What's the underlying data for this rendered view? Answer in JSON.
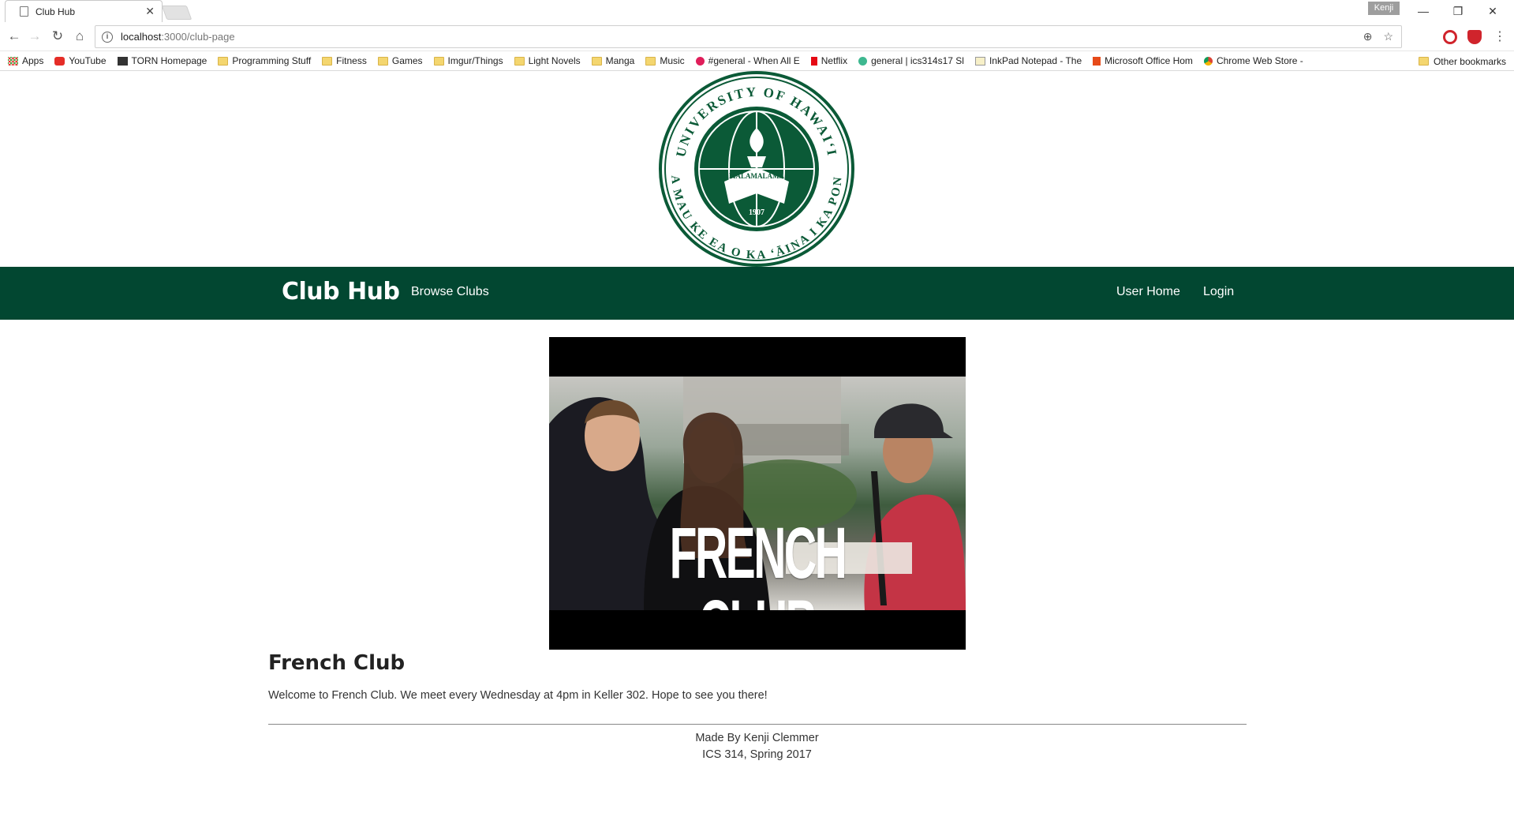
{
  "browser": {
    "tab_title": "Club Hub",
    "profile_name": "Kenji",
    "url_host": "localhost",
    "url_path": ":3000/club-page",
    "bookmarks": [
      {
        "label": "Apps",
        "icon": "apps-grid-icon"
      },
      {
        "label": "YouTube",
        "icon": "youtube-icon"
      },
      {
        "label": "TORN Homepage",
        "icon": "torn-icon"
      },
      {
        "label": "Programming Stuff",
        "icon": "folder-icon"
      },
      {
        "label": "Fitness",
        "icon": "folder-icon"
      },
      {
        "label": "Games",
        "icon": "folder-icon"
      },
      {
        "label": "Imgur/Things",
        "icon": "folder-icon"
      },
      {
        "label": "Light Novels",
        "icon": "folder-icon"
      },
      {
        "label": "Manga",
        "icon": "folder-icon"
      },
      {
        "label": "Music",
        "icon": "folder-icon"
      },
      {
        "label": "#general - When All E",
        "icon": "slack-icon"
      },
      {
        "label": "Netflix",
        "icon": "netflix-icon"
      },
      {
        "label": "general | ics314s17 Sl",
        "icon": "slack-icon"
      },
      {
        "label": "InkPad Notepad - The",
        "icon": "notepad-icon"
      },
      {
        "label": "Microsoft Office Hom",
        "icon": "office-icon"
      },
      {
        "label": "Chrome Web Store - ",
        "icon": "chrome-store-icon"
      }
    ],
    "other_bookmarks": "Other bookmarks"
  },
  "header": {
    "seal_top_text": "UNIVERSITY OF HAWAI‘I",
    "seal_bottom_text": "UA MAU KE EA O KA ‘ĀINA I KA PONO",
    "seal_center_text": "MĀLAMALAMA",
    "seal_year": "1907"
  },
  "nav": {
    "brand": "Club Hub",
    "browse": "Browse Clubs",
    "user_home": "User Home",
    "login": "Login",
    "bg_color": "#024731"
  },
  "club": {
    "banner_text": "FRENCH CLUB",
    "name": "French Club",
    "description": "Welcome to French Club. We meet every Wednesday at 4pm in Keller 302. Hope to see you there!"
  },
  "footer": {
    "line1": "Made By Kenji Clemmer",
    "line2": "ICS 314, Spring 2017"
  }
}
